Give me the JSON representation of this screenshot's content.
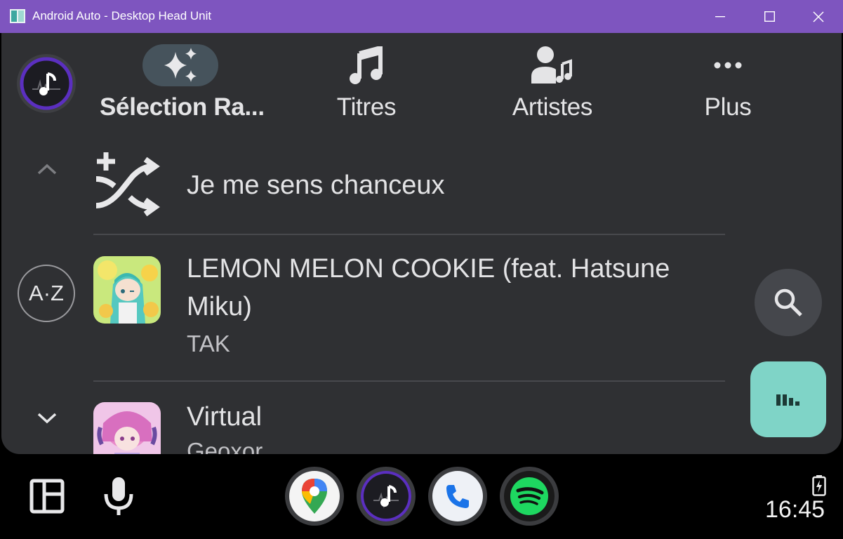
{
  "window": {
    "title": "Android Auto - Desktop Head Unit"
  },
  "tabs": [
    {
      "label": "Sélection Ra...",
      "icon": "sparkles-icon",
      "selected": true
    },
    {
      "label": "Titres",
      "icon": "music-note-icon",
      "selected": false
    },
    {
      "label": "Artistes",
      "icon": "artist-icon",
      "selected": false
    },
    {
      "label": "Plus",
      "icon": "more-horizontal-icon",
      "selected": false
    }
  ],
  "side_controls": {
    "az_label": "A·Z"
  },
  "list": {
    "lucky": {
      "label": "Je me sens chanceux",
      "icon": "shuffle-sparkle-icon"
    },
    "songs": [
      {
        "title": "LEMON MELON COOKIE (feat. Hatsune Miku)",
        "artist": "TAK"
      },
      {
        "title": "Virtual",
        "artist": "Geoxor"
      }
    ]
  },
  "dock": {
    "apps": [
      "maps-icon",
      "music-app-icon",
      "phone-icon",
      "spotify-icon"
    ],
    "time": "16:45"
  },
  "colors": {
    "titlebar": "#7e55bf",
    "panel": "#2f3033",
    "accent_fab": "#7fd4c7",
    "selected_pill": "#46535c"
  }
}
